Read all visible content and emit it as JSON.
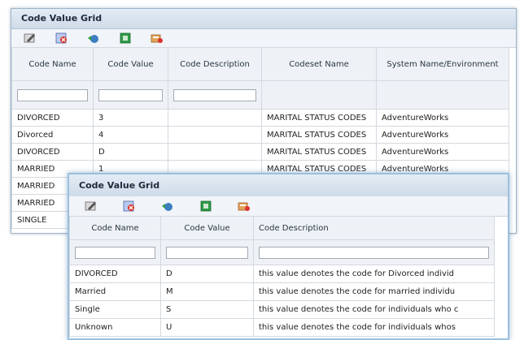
{
  "grid1": {
    "title": "Code Value Grid",
    "toolbar": [
      {
        "icon": "edit-icon"
      },
      {
        "icon": "delete-icon"
      },
      {
        "icon": "refresh-icon"
      },
      {
        "icon": "export-excel-icon"
      },
      {
        "icon": "import-icon"
      }
    ],
    "columns": [
      "Code Name",
      "Code Value",
      "Code Description",
      "Codeset Name",
      "System Name/Environment"
    ],
    "rows": [
      [
        "DIVORCED",
        "3",
        "",
        "MARITAL STATUS CODES",
        "AdventureWorks"
      ],
      [
        "Divorced",
        "4",
        "",
        "MARITAL STATUS CODES",
        "AdventureWorks"
      ],
      [
        "DIVORCED",
        "D",
        "",
        "MARITAL STATUS CODES",
        "AdventureWorks"
      ],
      [
        "MARRIED",
        "1",
        "",
        "MARITAL STATUS CODES",
        "AdventureWorks"
      ],
      [
        "MARRIED",
        "",
        "",
        "",
        ""
      ],
      [
        "MARRIED",
        "",
        "",
        "",
        ""
      ],
      [
        "SINGLE",
        "",
        "",
        "",
        ""
      ]
    ]
  },
  "grid2": {
    "title": "Code Value Grid",
    "toolbar": [
      {
        "icon": "edit-icon"
      },
      {
        "icon": "delete-icon"
      },
      {
        "icon": "refresh-icon"
      },
      {
        "icon": "export-excel-icon"
      },
      {
        "icon": "import-icon"
      }
    ],
    "columns": [
      "Code Name",
      "Code Value",
      "Code Description"
    ],
    "rows": [
      [
        "DIVORCED",
        "D",
        "this value denotes the code for Divorced individ"
      ],
      [
        "Married",
        "M",
        "this value denotes the code for married individu"
      ],
      [
        "Single",
        "S",
        "this value denotes the code for individuals who c"
      ],
      [
        "Unknown",
        "U",
        "this value denotes the code for individuals whos"
      ]
    ]
  },
  "colors": {
    "title_bg": "#d6e1ec",
    "header_bg": "#eef2f6",
    "border": "#d3d9e0",
    "panel_border": "#9cc0de"
  }
}
